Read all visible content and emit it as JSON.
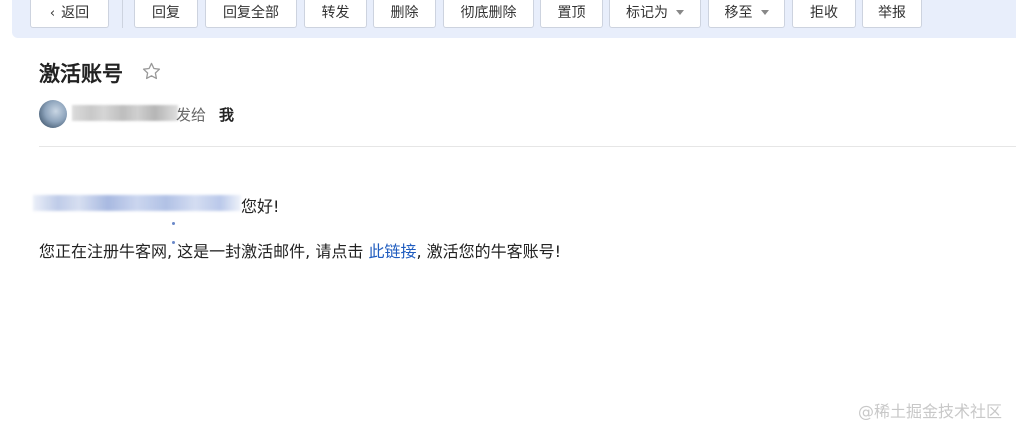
{
  "toolbar": {
    "back_label": "返回",
    "reply_label": "回复",
    "reply_all_label": "回复全部",
    "forward_label": "转发",
    "delete_label": "删除",
    "delete_permanently_label": "彻底删除",
    "pin_label": "置顶",
    "mark_as_label": "标记为",
    "move_to_label": "移至",
    "reject_label": "拒收",
    "report_label": "举报"
  },
  "email": {
    "subject": "激活账号",
    "sent_to_label": "发给",
    "recipient": "我",
    "greeting_suffix": "您好!",
    "body_before_link": "您正在注册牛客网, 这是一封激活邮件, 请点击 ",
    "link_text": "此链接",
    "body_after_link": ", 激活您的牛客账号!"
  },
  "watermark": "@稀土掘金技术社区",
  "icons": {
    "back": "chevron-left-icon",
    "star": "star-outline-icon",
    "dropdown": "caret-down-icon"
  },
  "colors": {
    "toolbar_bg": "#e8eefb",
    "link": "#1f5cbf"
  }
}
